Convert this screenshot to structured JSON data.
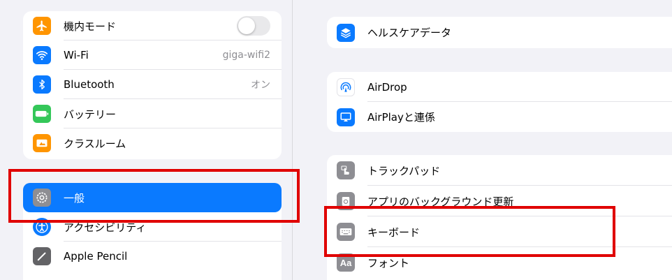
{
  "colors": {
    "accent": "#0a7aff",
    "annotation": "#e00000",
    "airplane": "#ff9500",
    "wifi": "#0a7aff",
    "bluetooth": "#0a7aff",
    "battery": "#34c759",
    "classroom": "#ff9500",
    "general": "#8e8e93",
    "accessibility": "#0a7aff",
    "pencil": "#636366"
  },
  "sidebar": {
    "group1": [
      {
        "label": "機内モード",
        "icon": "airplane-icon",
        "toggle": "off"
      },
      {
        "label": "Wi-Fi",
        "icon": "wifi-icon",
        "value": "giga-wifi2"
      },
      {
        "label": "Bluetooth",
        "icon": "bluetooth-icon",
        "value": "オン"
      },
      {
        "label": "バッテリー",
        "icon": "battery-icon"
      },
      {
        "label": "クラスルーム",
        "icon": "classroom-icon"
      }
    ],
    "group2": [
      {
        "label": "一般",
        "icon": "gear-icon",
        "selected": true
      },
      {
        "label": "アクセシビリティ",
        "icon": "accessibility-icon"
      },
      {
        "label": "Apple Pencil",
        "icon": "pencil-icon"
      }
    ]
  },
  "main": {
    "group1": [
      {
        "label": "ヘルスケアデータ",
        "icon": "health-data-icon"
      }
    ],
    "group2": [
      {
        "label": "AirDrop",
        "icon": "airdrop-icon"
      },
      {
        "label": "AirPlayと連係",
        "icon": "airplay-icon"
      }
    ],
    "group3": [
      {
        "label": "トラックパッド",
        "icon": "trackpad-icon"
      },
      {
        "label": "アプリのバックグラウンド更新",
        "icon": "background-refresh-icon"
      },
      {
        "label": "キーボード",
        "icon": "keyboard-icon"
      },
      {
        "label": "フォント",
        "icon": "font-icon"
      }
    ]
  }
}
